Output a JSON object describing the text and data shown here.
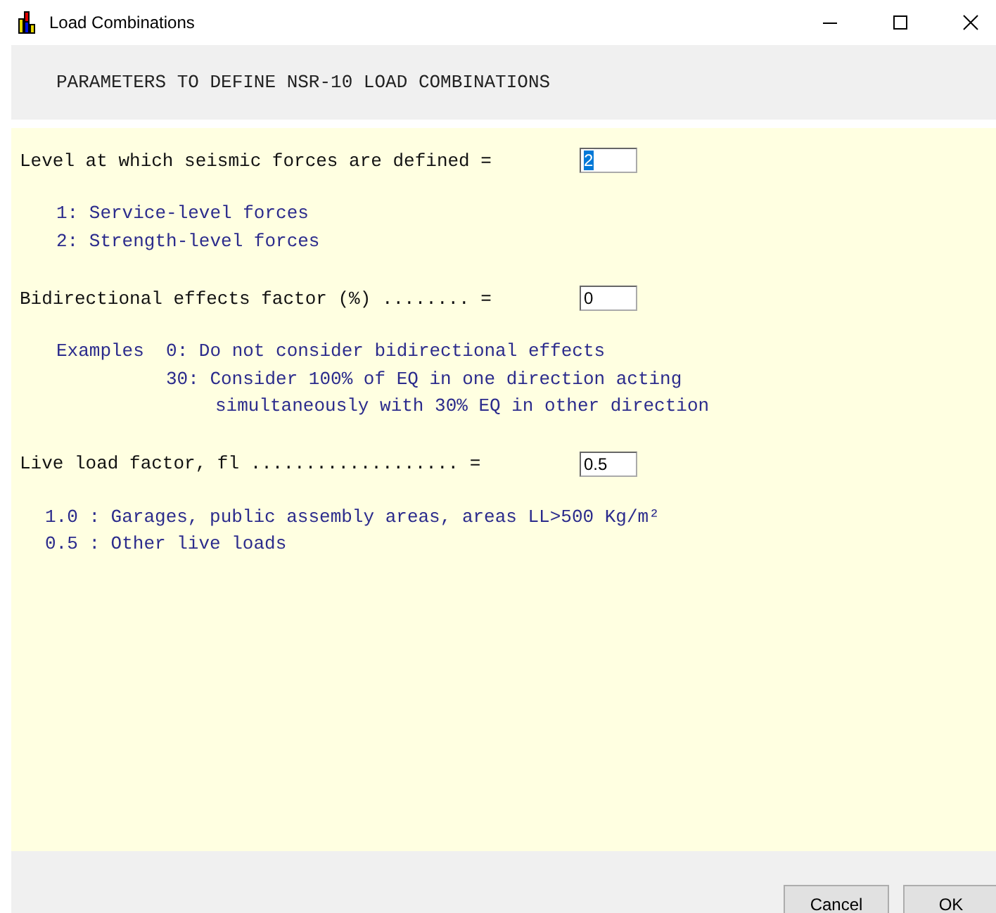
{
  "window": {
    "title": "Load Combinations"
  },
  "header": "PARAMETERS TO DEFINE NSR-10 LOAD COMBINATIONS",
  "parameters": [
    {
      "label": "Level at which seismic forces are defined =",
      "value": "2",
      "selected": true,
      "notes": [
        {
          "text": "1: Service-level forces",
          "kind": "option"
        },
        {
          "text": "2: Strength-level forces",
          "kind": "option"
        }
      ]
    },
    {
      "label": "Bidirectional effects factor (%) ........ =",
      "value": "0",
      "selected": false,
      "notes": [
        {
          "text": "Examples  0: Do not consider bidirectional effects",
          "kind": "example"
        },
        {
          "text": "30: Consider 100% of EQ in one direction acting",
          "kind": "example-value"
        },
        {
          "text": "simultaneously with 30% EQ in other direction",
          "kind": "continuation"
        }
      ]
    },
    {
      "label": "Live load factor, fl ................... =",
      "value": "0.5",
      "selected": false,
      "notes": [
        {
          "text": "1.0 : Garages, public assembly areas, areas LL>500 Kg/m²",
          "kind": "factor-value"
        },
        {
          "text": "0.5 : Other live loads",
          "kind": "factor-value"
        }
      ]
    }
  ],
  "buttons": [
    "Cancel",
    "OK"
  ]
}
